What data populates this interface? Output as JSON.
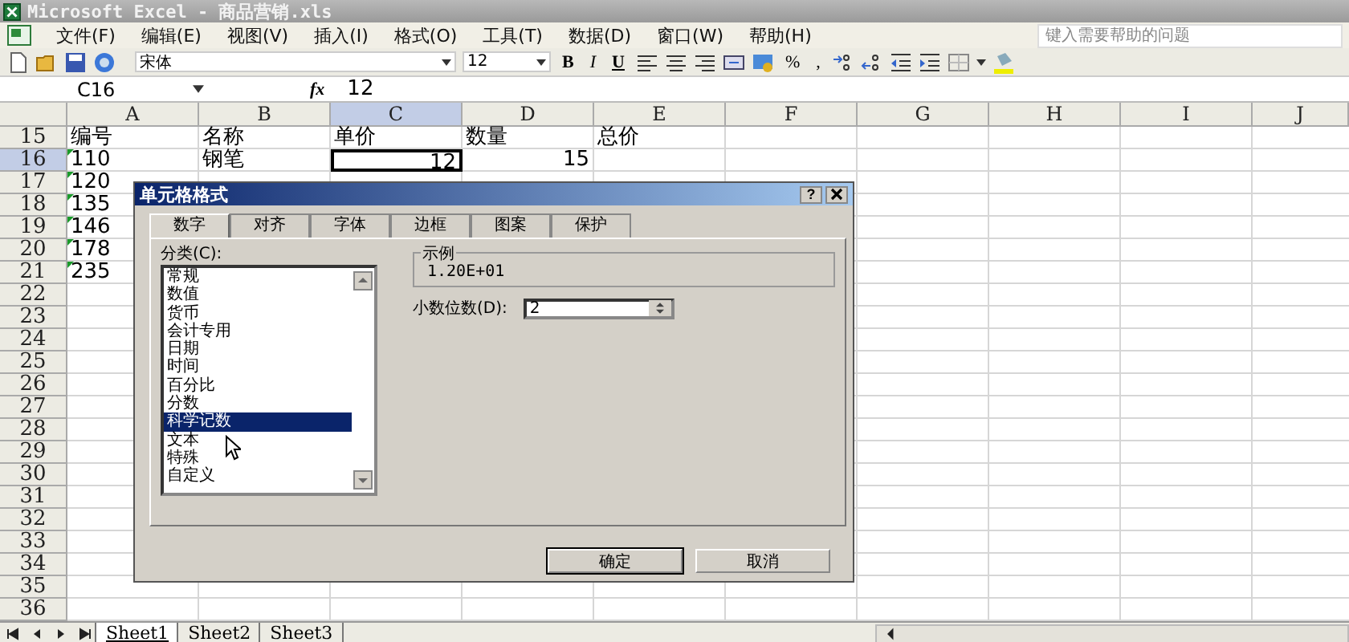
{
  "window": {
    "title": "Microsoft Excel - 商品营销.xls"
  },
  "menu": [
    "文件(F)",
    "编辑(E)",
    "视图(V)",
    "插入(I)",
    "格式(O)",
    "工具(T)",
    "数据(D)",
    "窗口(W)",
    "帮助(H)"
  ],
  "help_search": {
    "placeholder": "键入需要帮助的问题"
  },
  "toolbar": {
    "font": "宋体",
    "size": "12",
    "bold": "B",
    "italic": "I",
    "underline": "U",
    "percent": "%",
    "comma": ","
  },
  "formula_bar": {
    "name_box": "C16",
    "function_label": "fx",
    "formula": "12"
  },
  "columns": [
    {
      "label": "A",
      "selected": false
    },
    {
      "label": "B",
      "selected": false
    },
    {
      "label": "C",
      "selected": true
    },
    {
      "label": "D",
      "selected": false
    },
    {
      "label": "E",
      "selected": false
    },
    {
      "label": "F",
      "selected": false
    },
    {
      "label": "G",
      "selected": false
    },
    {
      "label": "H",
      "selected": false
    },
    {
      "label": "I",
      "selected": false
    },
    {
      "label": "J",
      "selected": false
    }
  ],
  "rows": [
    {
      "number": "15",
      "selected": false,
      "cells": [
        {
          "text": "编号",
          "kind": "text",
          "flag": false,
          "selected": false
        },
        {
          "text": "名称",
          "kind": "text",
          "flag": false,
          "selected": false
        },
        {
          "text": "单价",
          "kind": "text",
          "flag": false,
          "selected": false
        },
        {
          "text": "数量",
          "kind": "text",
          "flag": false,
          "selected": false
        },
        {
          "text": "总价",
          "kind": "text",
          "flag": false,
          "selected": false
        }
      ]
    },
    {
      "number": "16",
      "selected": true,
      "cells": [
        {
          "text": "110",
          "kind": "text",
          "flag": true,
          "selected": false
        },
        {
          "text": "钢笔",
          "kind": "text",
          "flag": false,
          "selected": false
        },
        {
          "text": "12",
          "kind": "number",
          "flag": false,
          "selected": true
        },
        {
          "text": "15",
          "kind": "number",
          "flag": false,
          "selected": false
        }
      ]
    },
    {
      "number": "17",
      "selected": false,
      "cells": [
        {
          "text": "120",
          "kind": "text",
          "flag": true,
          "selected": false
        }
      ]
    },
    {
      "number": "18",
      "selected": false,
      "cells": [
        {
          "text": "135",
          "kind": "text",
          "flag": true,
          "selected": false
        }
      ]
    },
    {
      "number": "19",
      "selected": false,
      "cells": [
        {
          "text": "146",
          "kind": "text",
          "flag": true,
          "selected": false
        }
      ]
    },
    {
      "number": "20",
      "selected": false,
      "cells": [
        {
          "text": "178",
          "kind": "text",
          "flag": true,
          "selected": false
        }
      ]
    },
    {
      "number": "21",
      "selected": false,
      "cells": [
        {
          "text": "235",
          "kind": "text",
          "flag": true,
          "selected": false
        }
      ]
    },
    {
      "number": "22",
      "selected": false,
      "cells": []
    },
    {
      "number": "23",
      "selected": false,
      "cells": []
    },
    {
      "number": "24",
      "selected": false,
      "cells": []
    },
    {
      "number": "25",
      "selected": false,
      "cells": []
    },
    {
      "number": "26",
      "selected": false,
      "cells": []
    },
    {
      "number": "27",
      "selected": false,
      "cells": []
    },
    {
      "number": "28",
      "selected": false,
      "cells": []
    },
    {
      "number": "29",
      "selected": false,
      "cells": []
    },
    {
      "number": "30",
      "selected": false,
      "cells": []
    },
    {
      "number": "31",
      "selected": false,
      "cells": []
    },
    {
      "number": "32",
      "selected": false,
      "cells": []
    },
    {
      "number": "33",
      "selected": false,
      "cells": []
    },
    {
      "number": "34",
      "selected": false,
      "cells": []
    },
    {
      "number": "35",
      "selected": false,
      "cells": []
    },
    {
      "number": "36",
      "selected": false,
      "cells": []
    }
  ],
  "sheet_tabs": [
    {
      "label": "Sheet1",
      "selected": true
    },
    {
      "label": "Sheet2",
      "selected": false
    },
    {
      "label": "Sheet3",
      "selected": false
    }
  ],
  "dialog": {
    "title": "单元格格式",
    "help_button": "?",
    "tabs": [
      {
        "label": "数字",
        "selected": true
      },
      {
        "label": "对齐",
        "selected": false
      },
      {
        "label": "字体",
        "selected": false
      },
      {
        "label": "边框",
        "selected": false
      },
      {
        "label": "图案",
        "selected": false
      },
      {
        "label": "保护",
        "selected": false
      }
    ],
    "category_label": "分类(C):",
    "categories": [
      {
        "label": "常规",
        "selected": false
      },
      {
        "label": "数值",
        "selected": false
      },
      {
        "label": "货币",
        "selected": false
      },
      {
        "label": "会计专用",
        "selected": false
      },
      {
        "label": "日期",
        "selected": false
      },
      {
        "label": "时间",
        "selected": false
      },
      {
        "label": "百分比",
        "selected": false
      },
      {
        "label": "分数",
        "selected": false
      },
      {
        "label": "科学记数",
        "selected": true
      },
      {
        "label": "文本",
        "selected": false
      },
      {
        "label": "特殊",
        "selected": false
      },
      {
        "label": "自定义",
        "selected": false
      }
    ],
    "sample_label": "示例",
    "sample_value": "1.20E+01",
    "decimals_label": "小数位数(D):",
    "decimals_value": "2",
    "buttons": [
      {
        "label": "确定",
        "default": true
      },
      {
        "label": "取消",
        "default": false
      }
    ]
  }
}
